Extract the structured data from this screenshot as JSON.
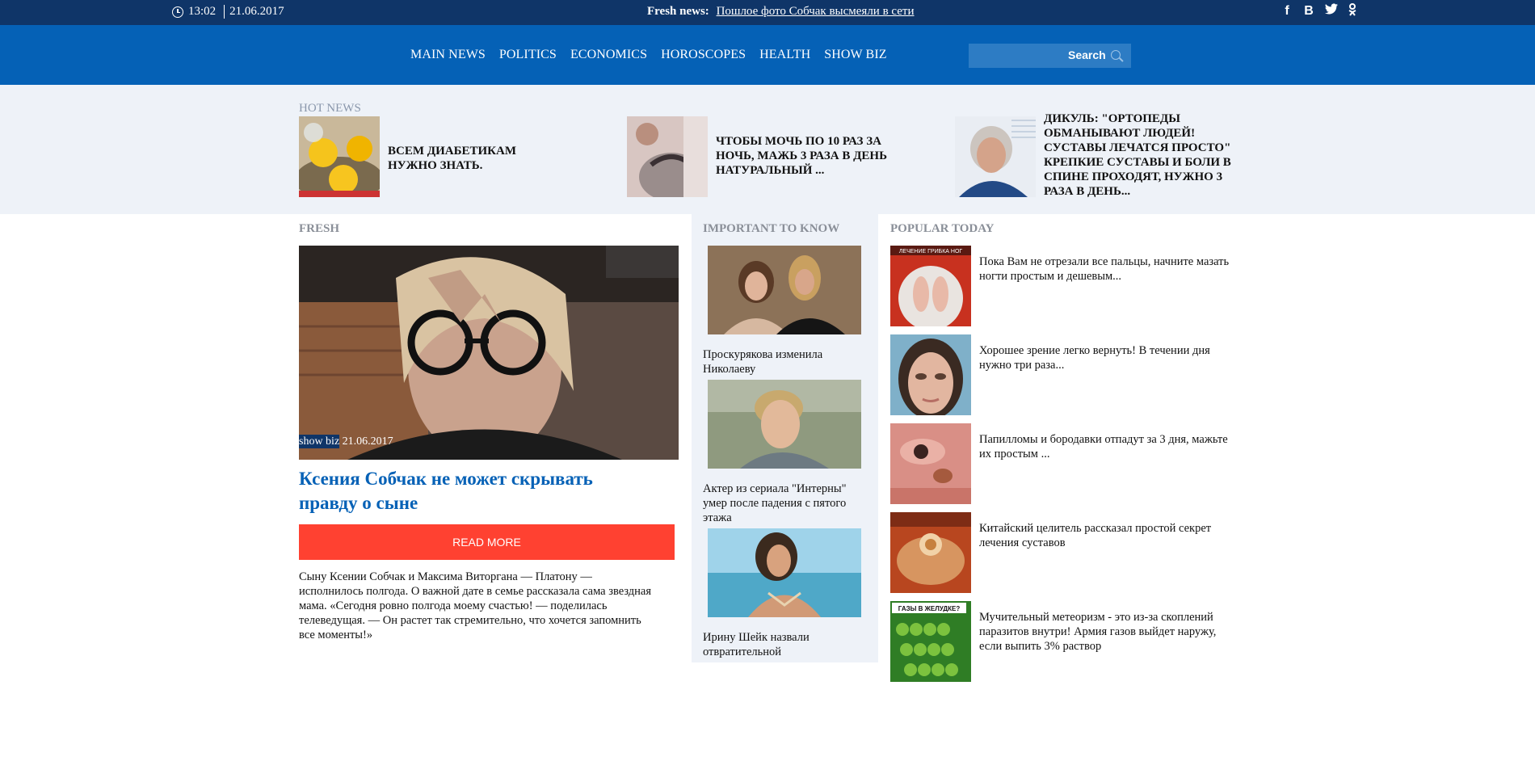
{
  "topbar": {
    "time": "13:02",
    "date": "21.06.2017",
    "fresh_label": "Fresh news:",
    "fresh_link": "Пошлое фото Собчак высмеяли в сети",
    "social": [
      "f",
      "B",
      "t",
      "ok"
    ]
  },
  "nav": {
    "items": [
      "MAIN NEWS",
      "POLITICS",
      "ECONOMICS",
      "HOROSCOPES",
      "HEALTH",
      "SHOW BIZ"
    ],
    "search_label": "Search",
    "search_placeholder": ""
  },
  "hot": {
    "label": "HOT NEWS",
    "items": [
      {
        "text": "Всем диабетикам нужно знать."
      },
      {
        "text": "Чтобы мочь по 10 раз за ночь, мажь 3 раза в день натуральный ..."
      },
      {
        "text": "Дикуль: \"Ортопеды обманывают людей! Суставы лечатся просто\" Крепкие суставы и боли в спине проходят, нужно 3 раза в день..."
      }
    ]
  },
  "fresh": {
    "label": "FRESH",
    "category": "show biz",
    "date": "21.06.2017",
    "title": "Ксения Собчак не может скрывать правду о сыне",
    "read_more": "READ MORE",
    "description": "Сыну Ксении Собчак и Максима Виторгана — Платону — исполнилось полгода. О важной дате в семье рассказала сама звездная мама. «Сегодня ровно полгода моему счастью! — поделилась телеведущая. — Он растет так стремительно, что хочется запомнить все моменты!»"
  },
  "important": {
    "label": "IMPORTANT TO KNOW",
    "items": [
      {
        "caption": "Проскурякова изменила Николаеву"
      },
      {
        "caption": "Актер из сериала \"Интерны\" умер после падения с пятого этажа"
      },
      {
        "caption": "Ирину Шейк назвали отвратительной"
      }
    ]
  },
  "popular": {
    "label": "POPULAR TODAY",
    "items": [
      {
        "caption": "Пока Вам не отрезали все пальцы, начните мазать ногти простым и дешевым...",
        "thumb_text": "ЛЕЧЕНИЕ ГРИБКА НОГ"
      },
      {
        "caption": "Хорошее зрение легко вернуть! В течении дня нужно три раза..."
      },
      {
        "caption": "Папилломы и бородавки отпадут за 3 дня, мажьте их простым ..."
      },
      {
        "caption": "Китайский целитель рассказал простой секрет лечения суставов"
      },
      {
        "caption": "Мучительный метеоризм - это из-за скоплений паразитов внутри! Армия газов выйдет наружу, если выпить 3% раствор",
        "thumb_text": "ГАЗЫ В ЖЕЛУДКЕ?"
      }
    ]
  }
}
